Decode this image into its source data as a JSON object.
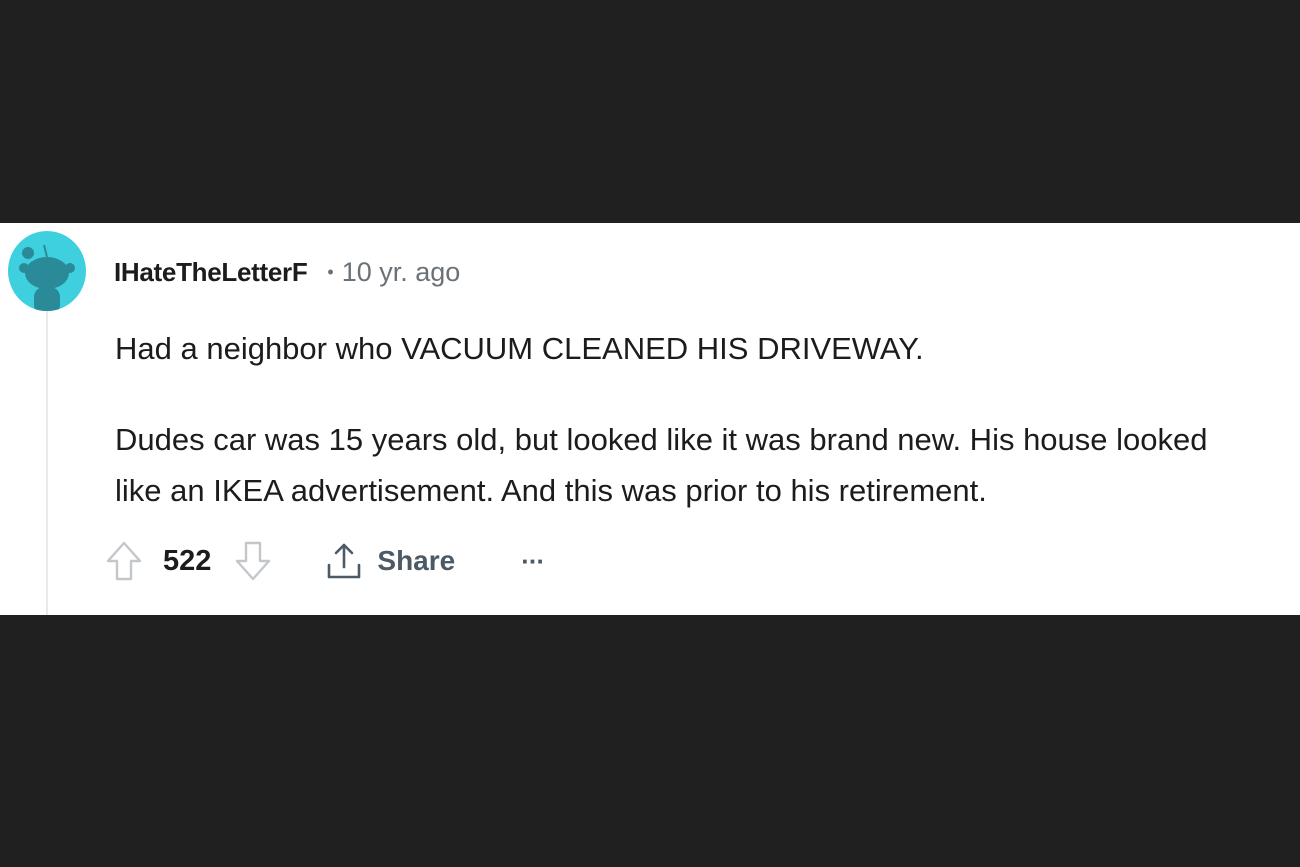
{
  "comment": {
    "author": "IHateTheLetterF",
    "separator": "•",
    "timestamp": "10 yr. ago",
    "paragraphs": [
      "Had a neighbor who VACUUM CLEANED HIS DRIVEWAY.",
      "Dudes car was 15 years old, but looked like it was brand new. His house looked",
      "like an IKEA advertisement. And this was prior to his retirement."
    ],
    "votes": "522",
    "share_label": "Share",
    "more_label": "···"
  },
  "icons": {
    "avatar": "reddit-snoo-avatar-icon",
    "upvote": "arrow-up-outline-icon",
    "downvote": "arrow-down-outline-icon",
    "share": "share-upload-icon"
  },
  "colors": {
    "page_background": "#202020",
    "card_background": "#ffffff",
    "avatar_background": "#3fd0e0",
    "text_primary": "#1c1c1c",
    "text_secondary": "#6a7278",
    "action_text": "#4c5a66",
    "thread_line": "#e7e9eb"
  }
}
